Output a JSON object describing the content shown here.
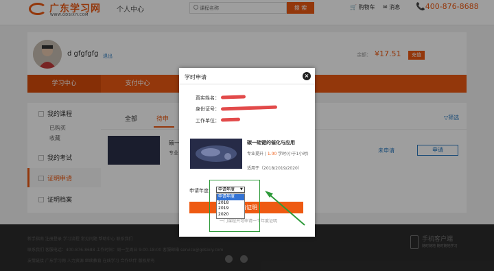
{
  "header": {
    "logo_text": "广东学习网",
    "logo_sub": "WWW.GDSIXIY.COM",
    "section_title": "个人中心",
    "search_placeholder": "课程名称",
    "search_button": "搜 索",
    "cart": "购物车",
    "messages": "消息",
    "phone": "400-876-8688"
  },
  "user": {
    "name": "d gfgfgfg",
    "logout": "退出",
    "balance_label": "余额：",
    "balance_value": "¥17.51",
    "recharge": "充值"
  },
  "nav": {
    "items": [
      "学习中心",
      "支付中心"
    ]
  },
  "sidebar": {
    "my_courses": "我的课程",
    "purchased": "已购买",
    "favorites": "收藏",
    "my_exams": "我的考试",
    "cert_apply": "证明申请",
    "cert_archive": "证明档案"
  },
  "main": {
    "tabs": [
      "全部",
      "待申"
    ],
    "filter": "筛选",
    "course_title": "碳一",
    "course_sub": "专业 适用",
    "status": "未申请",
    "apply_button": "申请"
  },
  "footer": {
    "line1": "新手指南 注册登录 学习流程 常见问题 帮助中心 联系我们",
    "line2": "联系我们 客服电话：400-876-8688 工作时间：周一至周日 9:00-18:00 客服邮箱 service@gdsixiy.com",
    "line3": "友情链接 广东学习网 人力资源 继续教育 在线学习 合作伙伴 版权所有",
    "app_title": "手机客户端",
    "app_sub": "随时随地 随时随地学习"
  },
  "modal": {
    "title": "学时申请",
    "close": "×",
    "name_label": "真实姓名：",
    "id_label": "身份证号：",
    "work_label": "工作单位：",
    "course_title": "碳一硅键的催化与应用",
    "course_type_label": "专业提升 |",
    "course_hours": "1.00",
    "course_hours_text": "学时(小于1小时)",
    "applicable": "适用于（2018/2019/2020）",
    "year_label": "申请年度：",
    "year_selected": "申请年度",
    "year_options": [
      "申请年度",
      "2018",
      "2019",
      "2020"
    ],
    "submit": "申请证明",
    "note": "一门课程只可申请一个年度证明"
  }
}
